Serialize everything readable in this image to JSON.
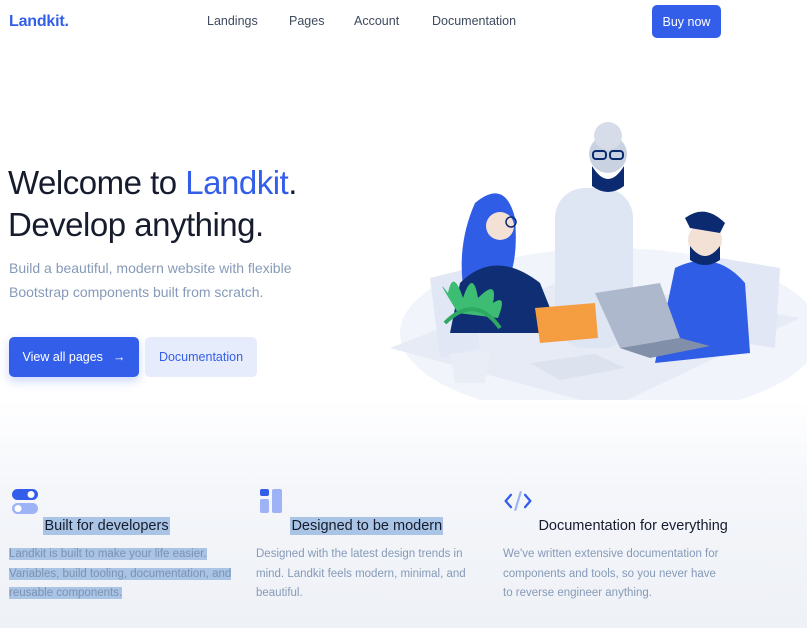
{
  "nav": {
    "brand": "Landkit.",
    "links": [
      "Landings",
      "Pages",
      "Account",
      "Documentation"
    ],
    "cta": "Buy now"
  },
  "hero": {
    "title_prefix": "Welcome to ",
    "title_accent": "Landkit",
    "title_period": ".",
    "title_line2": "Develop anything.",
    "subtitle": "Build a beautiful, modern website with flexible Bootstrap components built from scratch.",
    "primary_btn": "View all pages",
    "primary_btn_arrow": "→",
    "secondary_btn": "Documentation"
  },
  "features": [
    {
      "icon": "toggle-icon",
      "title": "Built for developers",
      "text": "Landkit is built to make your life easier. Variables, build tooling, documentation, and reusable components."
    },
    {
      "icon": "layout-icon",
      "title": "Designed to be modern",
      "text": "Designed with the latest design trends in mind. Landkit feels modern, minimal, and beautiful."
    },
    {
      "icon": "code-icon",
      "title": "Documentation for everything",
      "text": "We've written extensive documentation for components and tools, so you never have to reverse engineer anything."
    }
  ],
  "colors": {
    "primary": "#335eea",
    "text": "#161c2d",
    "muted": "#869ab8",
    "selection": "#a9c4e4"
  }
}
